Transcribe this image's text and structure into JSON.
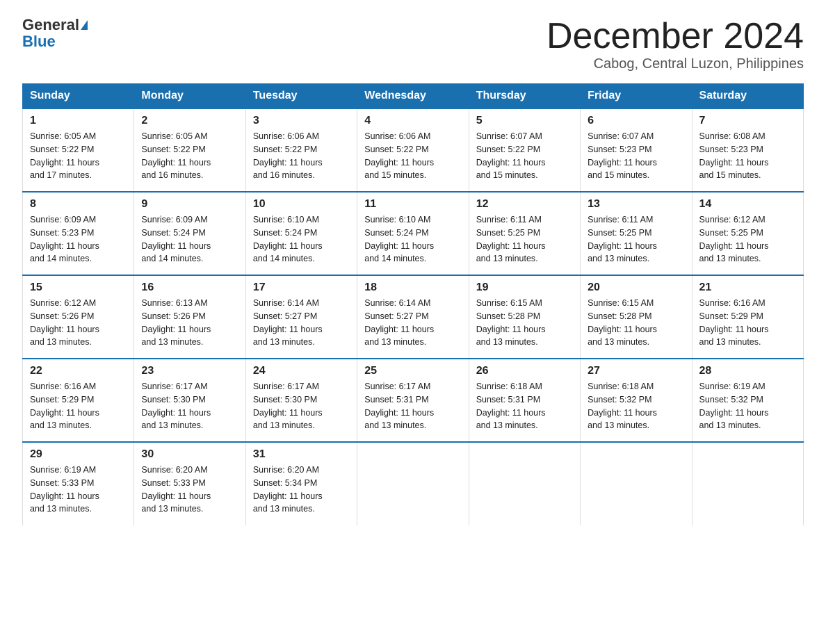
{
  "header": {
    "logo_general": "General",
    "logo_blue": "Blue",
    "month_title": "December 2024",
    "location": "Cabog, Central Luzon, Philippines"
  },
  "days_of_week": [
    "Sunday",
    "Monday",
    "Tuesday",
    "Wednesday",
    "Thursday",
    "Friday",
    "Saturday"
  ],
  "weeks": [
    [
      {
        "day": "1",
        "sunrise": "6:05 AM",
        "sunset": "5:22 PM",
        "daylight": "11 hours and 17 minutes."
      },
      {
        "day": "2",
        "sunrise": "6:05 AM",
        "sunset": "5:22 PM",
        "daylight": "11 hours and 16 minutes."
      },
      {
        "day": "3",
        "sunrise": "6:06 AM",
        "sunset": "5:22 PM",
        "daylight": "11 hours and 16 minutes."
      },
      {
        "day": "4",
        "sunrise": "6:06 AM",
        "sunset": "5:22 PM",
        "daylight": "11 hours and 15 minutes."
      },
      {
        "day": "5",
        "sunrise": "6:07 AM",
        "sunset": "5:22 PM",
        "daylight": "11 hours and 15 minutes."
      },
      {
        "day": "6",
        "sunrise": "6:07 AM",
        "sunset": "5:23 PM",
        "daylight": "11 hours and 15 minutes."
      },
      {
        "day": "7",
        "sunrise": "6:08 AM",
        "sunset": "5:23 PM",
        "daylight": "11 hours and 15 minutes."
      }
    ],
    [
      {
        "day": "8",
        "sunrise": "6:09 AM",
        "sunset": "5:23 PM",
        "daylight": "11 hours and 14 minutes."
      },
      {
        "day": "9",
        "sunrise": "6:09 AM",
        "sunset": "5:24 PM",
        "daylight": "11 hours and 14 minutes."
      },
      {
        "day": "10",
        "sunrise": "6:10 AM",
        "sunset": "5:24 PM",
        "daylight": "11 hours and 14 minutes."
      },
      {
        "day": "11",
        "sunrise": "6:10 AM",
        "sunset": "5:24 PM",
        "daylight": "11 hours and 14 minutes."
      },
      {
        "day": "12",
        "sunrise": "6:11 AM",
        "sunset": "5:25 PM",
        "daylight": "11 hours and 13 minutes."
      },
      {
        "day": "13",
        "sunrise": "6:11 AM",
        "sunset": "5:25 PM",
        "daylight": "11 hours and 13 minutes."
      },
      {
        "day": "14",
        "sunrise": "6:12 AM",
        "sunset": "5:25 PM",
        "daylight": "11 hours and 13 minutes."
      }
    ],
    [
      {
        "day": "15",
        "sunrise": "6:12 AM",
        "sunset": "5:26 PM",
        "daylight": "11 hours and 13 minutes."
      },
      {
        "day": "16",
        "sunrise": "6:13 AM",
        "sunset": "5:26 PM",
        "daylight": "11 hours and 13 minutes."
      },
      {
        "day": "17",
        "sunrise": "6:14 AM",
        "sunset": "5:27 PM",
        "daylight": "11 hours and 13 minutes."
      },
      {
        "day": "18",
        "sunrise": "6:14 AM",
        "sunset": "5:27 PM",
        "daylight": "11 hours and 13 minutes."
      },
      {
        "day": "19",
        "sunrise": "6:15 AM",
        "sunset": "5:28 PM",
        "daylight": "11 hours and 13 minutes."
      },
      {
        "day": "20",
        "sunrise": "6:15 AM",
        "sunset": "5:28 PM",
        "daylight": "11 hours and 13 minutes."
      },
      {
        "day": "21",
        "sunrise": "6:16 AM",
        "sunset": "5:29 PM",
        "daylight": "11 hours and 13 minutes."
      }
    ],
    [
      {
        "day": "22",
        "sunrise": "6:16 AM",
        "sunset": "5:29 PM",
        "daylight": "11 hours and 13 minutes."
      },
      {
        "day": "23",
        "sunrise": "6:17 AM",
        "sunset": "5:30 PM",
        "daylight": "11 hours and 13 minutes."
      },
      {
        "day": "24",
        "sunrise": "6:17 AM",
        "sunset": "5:30 PM",
        "daylight": "11 hours and 13 minutes."
      },
      {
        "day": "25",
        "sunrise": "6:17 AM",
        "sunset": "5:31 PM",
        "daylight": "11 hours and 13 minutes."
      },
      {
        "day": "26",
        "sunrise": "6:18 AM",
        "sunset": "5:31 PM",
        "daylight": "11 hours and 13 minutes."
      },
      {
        "day": "27",
        "sunrise": "6:18 AM",
        "sunset": "5:32 PM",
        "daylight": "11 hours and 13 minutes."
      },
      {
        "day": "28",
        "sunrise": "6:19 AM",
        "sunset": "5:32 PM",
        "daylight": "11 hours and 13 minutes."
      }
    ],
    [
      {
        "day": "29",
        "sunrise": "6:19 AM",
        "sunset": "5:33 PM",
        "daylight": "11 hours and 13 minutes."
      },
      {
        "day": "30",
        "sunrise": "6:20 AM",
        "sunset": "5:33 PM",
        "daylight": "11 hours and 13 minutes."
      },
      {
        "day": "31",
        "sunrise": "6:20 AM",
        "sunset": "5:34 PM",
        "daylight": "11 hours and 13 minutes."
      },
      null,
      null,
      null,
      null
    ]
  ],
  "labels": {
    "sunrise": "Sunrise:",
    "sunset": "Sunset:",
    "daylight": "Daylight:"
  }
}
